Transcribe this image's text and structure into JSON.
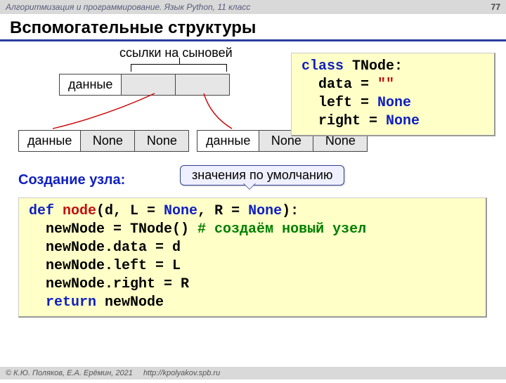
{
  "header": {
    "course": "Алгоритмизация и программирование. Язык Python, 11 класс",
    "page": "77"
  },
  "title": "Вспомогательные структуры",
  "labels": {
    "links_to_children": "ссылки на сыновей",
    "data": "данные",
    "none": "None",
    "create_node": "Создание узла:",
    "defaults": "значения по умолчанию"
  },
  "code_class": {
    "l1a": "class",
    "l1b": " TNode:",
    "l2a": "  data = ",
    "l2b": "\"\"",
    "l3a": "  left = ",
    "l3b": "None",
    "l4a": "  right = ",
    "l4b": "None"
  },
  "code_func": {
    "l1a": "def",
    "l1b": " node",
    "l1c": "(d, L = ",
    "l1d": "None",
    "l1e": ", R = ",
    "l1f": "None",
    "l1g": "):",
    "l2a": "  newNode = TNode() ",
    "l2b": "# создаём новый узел",
    "l3": "  newNode.data = d",
    "l4": "  newNode.left = L",
    "l5": "  newNode.right = R",
    "l6a": "  ",
    "l6b": "return",
    "l6c": " newNode"
  },
  "footer": {
    "copyright": "© К.Ю. Поляков, Е.А. Ерёмин, 2021",
    "url": "http://kpolyakov.spb.ru"
  }
}
